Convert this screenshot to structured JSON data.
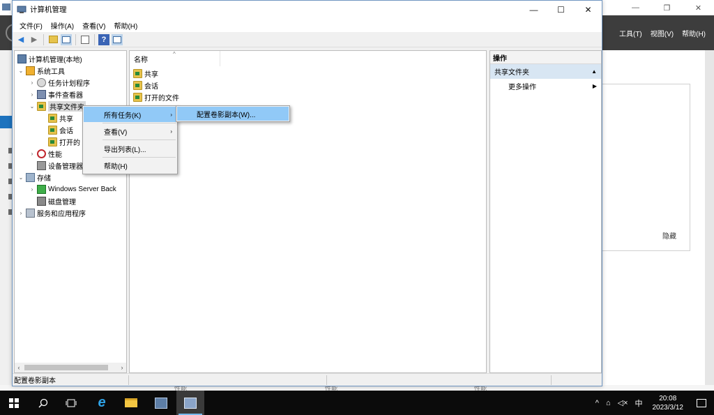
{
  "background_window": {
    "menu": [
      "工具(T)",
      "视图(V)",
      "帮助(H)"
    ],
    "hide_label": "隐藏",
    "status_labels": [
      "性能",
      "性能",
      "性能"
    ]
  },
  "window": {
    "title": "计算机管理",
    "menu": [
      "文件(F)",
      "操作(A)",
      "查看(V)",
      "帮助(H)"
    ]
  },
  "tree": {
    "root": "计算机管理(本地)",
    "system_tools": "系统工具",
    "task_scheduler": "任务计划程序",
    "event_viewer": "事件查看器",
    "shared_folders": "共享文件夹",
    "shares": "共享",
    "sessions": "会话",
    "open_files": "打开的",
    "performance": "性能",
    "device_manager": "设备管理器",
    "storage": "存储",
    "windows_server_backup": "Windows Server Back",
    "disk_management": "磁盘管理",
    "services_apps": "服务和应用程序"
  },
  "list": {
    "column_name": "名称",
    "rows": [
      "共享",
      "会话",
      "打开的文件"
    ]
  },
  "actions": {
    "header": "操作",
    "section": "共享文件夹",
    "more": "更多操作"
  },
  "context_menu": {
    "all_tasks": "所有任务(K)",
    "view": "查看(V)",
    "export_list": "导出列表(L)...",
    "help": "帮助(H)"
  },
  "submenu": {
    "configure_shadow_copies": "配置卷影副本(W)..."
  },
  "status_bar": {
    "text": "配置卷影副本"
  },
  "taskbar": {
    "time": "20:08",
    "date": "2023/3/12",
    "ime": "中"
  },
  "colors": {
    "highlight": "#91c9f7",
    "action_section": "#d8e6f3",
    "bg_header": "#3d3d3d",
    "taskbar": "#0b0b0b"
  }
}
